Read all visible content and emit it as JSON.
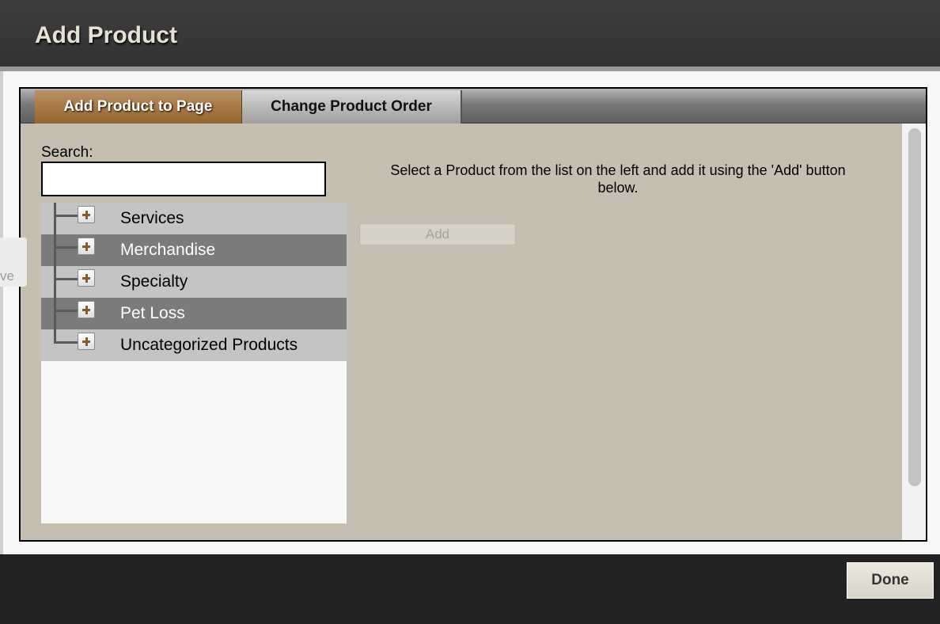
{
  "dialog": {
    "title": "Add Product"
  },
  "tabs": [
    {
      "label": "Add Product to Page",
      "active": true
    },
    {
      "label": "Change Product Order",
      "active": false
    }
  ],
  "search": {
    "label": "Search:",
    "value": "",
    "placeholder": ""
  },
  "tree": {
    "items": [
      {
        "label": "Services",
        "icon": "plus-expander-icon"
      },
      {
        "label": "Merchandise",
        "icon": "plus-expander-icon"
      },
      {
        "label": "Specialty",
        "icon": "plus-expander-icon"
      },
      {
        "label": "Pet Loss",
        "icon": "plus-expander-icon"
      },
      {
        "label": "Uncategorized Products",
        "icon": "plus-expander-icon"
      }
    ]
  },
  "instructions": "Select a Product from the list on the left and add it using the 'Add' button below.",
  "add_button": {
    "label": "Add",
    "disabled": true
  },
  "footer": {
    "done_label": "Done"
  },
  "side_peek": {
    "text": "ve"
  },
  "colors": {
    "active_tab": "#a87a45",
    "panel_bg": "#c5beb1",
    "tree_row_light": "#c4c4c4",
    "tree_row_dark": "#7b7b7b",
    "header_bg": "#3a3a3a"
  }
}
